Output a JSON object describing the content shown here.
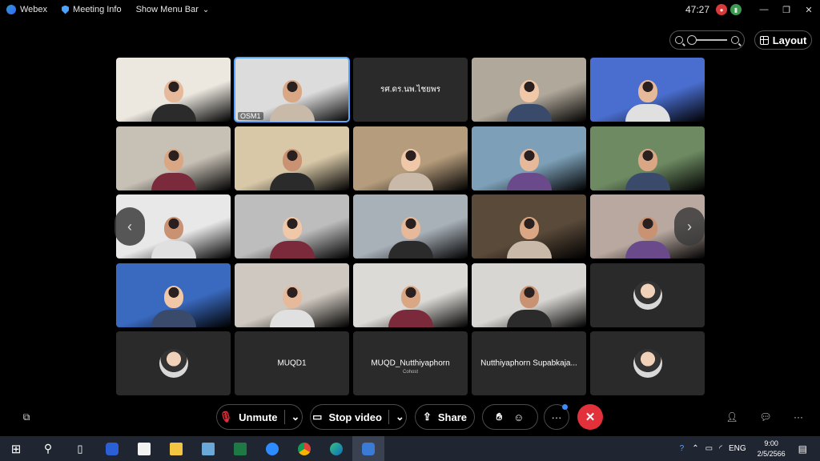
{
  "titlebar": {
    "app_name": "Webex",
    "meeting_info": "Meeting Info",
    "show_menu": "Show Menu Bar",
    "timer": "47:27"
  },
  "view": {
    "layout_label": "Layout"
  },
  "tiles": [
    {
      "name": "",
      "kind": "video",
      "bg": "#ece8e0"
    },
    {
      "name": "OSM1",
      "kind": "video",
      "bg": "#dcdcdc",
      "active": true
    },
    {
      "name": "รศ.ดร.นพ.ไชยพร",
      "kind": "name"
    },
    {
      "name": "",
      "kind": "video",
      "bg": "#b0a89a"
    },
    {
      "name": "",
      "kind": "video",
      "bg": "#4a6ecf"
    },
    {
      "name": "",
      "kind": "video",
      "bg": "#c7c0b5"
    },
    {
      "name": "",
      "kind": "video",
      "bg": "#d8c8a8"
    },
    {
      "name": "",
      "kind": "video",
      "bg": "#b59c7c"
    },
    {
      "name": "",
      "kind": "video",
      "bg": "#7da0b8"
    },
    {
      "name": "",
      "kind": "video",
      "bg": "#6d8a62"
    },
    {
      "name": "",
      "kind": "video",
      "bg": "#e8e8e8"
    },
    {
      "name": "",
      "kind": "video",
      "bg": "#bdbdbd"
    },
    {
      "name": "",
      "kind": "video",
      "bg": "#a8b0b8"
    },
    {
      "name": "",
      "kind": "video",
      "bg": "#5a4a3a"
    },
    {
      "name": "",
      "kind": "video",
      "bg": "#b8a8a0"
    },
    {
      "name": "",
      "kind": "video",
      "bg": "#3a6ac0"
    },
    {
      "name": "",
      "kind": "video",
      "bg": "#cfc8c0"
    },
    {
      "name": "",
      "kind": "video",
      "bg": "#dcdad6"
    },
    {
      "name": "",
      "kind": "video",
      "bg": "#d8d6d2"
    },
    {
      "name": "",
      "kind": "avatar"
    },
    {
      "name": "",
      "kind": "avatar"
    },
    {
      "name": "MUQD1",
      "kind": "name"
    },
    {
      "name": "MUQD_Nutthiyaphorn",
      "sub": "Cohost",
      "kind": "name"
    },
    {
      "name": "Nutthiyaphorn Supabkaja...",
      "kind": "name"
    },
    {
      "name": "",
      "kind": "avatar"
    }
  ],
  "controls": {
    "unmute": "Unmute",
    "stop_video": "Stop video",
    "share": "Share"
  },
  "taskbar": {
    "lang": "ENG",
    "time": "9:00",
    "date": "2/5/2566"
  },
  "colors": {
    "accent": "#5aa7ff",
    "end_call": "#e2313b",
    "taskbar": "#202631"
  }
}
